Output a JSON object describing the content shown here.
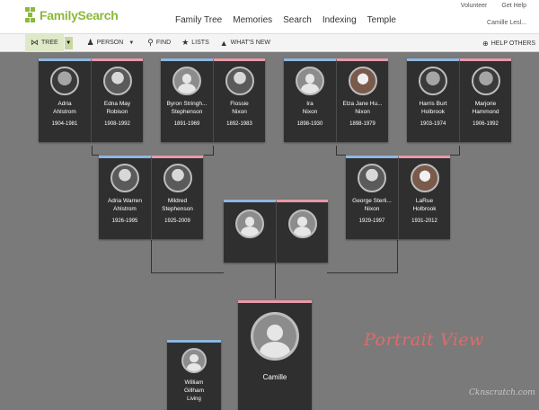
{
  "header": {
    "logo_text": "FamilySearch",
    "nav": [
      "Family Tree",
      "Memories",
      "Search",
      "Indexing",
      "Temple"
    ],
    "volunteer": "Volunteer",
    "get_help": "Get Help",
    "user_name": "Camille Lesl..."
  },
  "toolbar": {
    "tree": "TREE",
    "person": "PERSON",
    "find": "FIND",
    "lists": "LISTS",
    "whats_new": "WHAT'S NEW",
    "help_others": "HELP OTHERS"
  },
  "tree": {
    "gg": [
      {
        "husband": {
          "name1": "Adria",
          "name2": "Ahlstrom",
          "dates": "1904-1981"
        },
        "wife": {
          "name1": "Edna May",
          "name2": "Robison",
          "dates": "1908-1992"
        }
      },
      {
        "husband": {
          "name1": "Byron Stringh...",
          "name2": "Stephenson",
          "dates": "1891-1969"
        },
        "wife": {
          "name1": "Flossie",
          "name2": "Nixon",
          "dates": "1892-1983"
        }
      },
      {
        "husband": {
          "name1": "Ira",
          "name2": "Nixon",
          "dates": "1898-1930"
        },
        "wife": {
          "name1": "Elza Jane Hu...",
          "name2": "Nixon",
          "dates": "1898-1979"
        }
      },
      {
        "husband": {
          "name1": "Harris Burt",
          "name2": "Holbrook",
          "dates": "1903-1974"
        },
        "wife": {
          "name1": "Marjorie",
          "name2": "Hammond",
          "dates": "1906-1992"
        }
      }
    ],
    "gp": [
      {
        "husband": {
          "name1": "Adria Warren",
          "name2": "Ahlstrom",
          "dates": "1926-1995"
        },
        "wife": {
          "name1": "Mildred",
          "name2": "Stephenson",
          "dates": "1925-2009"
        }
      },
      {
        "husband": {
          "name1": "George Sterli...",
          "name2": "Nixon",
          "dates": "1929-1997"
        },
        "wife": {
          "name1": "LaRue",
          "name2": "Holbrook",
          "dates": "1931-2012"
        }
      }
    ],
    "focus": {
      "name": "Camille"
    },
    "child": {
      "name1": "William",
      "name2": "Gillham",
      "status": "Living"
    }
  },
  "overlay": {
    "watermark": "Portrait View",
    "credit": "Cknscratch.com"
  },
  "colors": {
    "male": "#8db8e0",
    "female": "#e79aa8",
    "brand": "#8cb93c"
  }
}
